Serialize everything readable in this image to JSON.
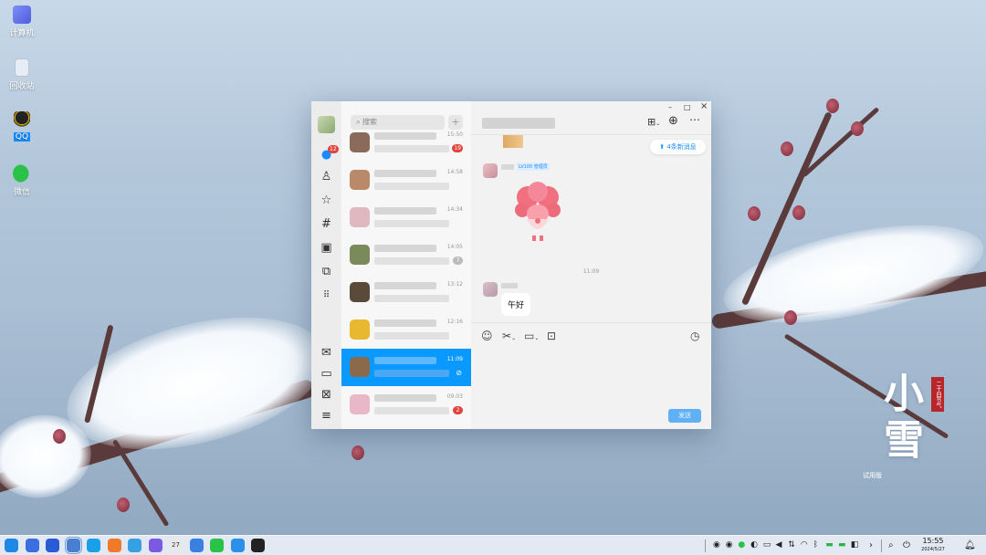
{
  "desktop": {
    "icons": [
      {
        "label": "计算机",
        "icon": "computer-icon",
        "color": "#6a7cf0"
      },
      {
        "label": "回收站",
        "icon": "recycle-bin-icon",
        "color": "#dfe8f2"
      },
      {
        "label": "QQ",
        "icon": "qq-icon",
        "color": "#1a1a1a"
      },
      {
        "label": "微信",
        "icon": "wechat-icon",
        "color": "#2bc24a"
      }
    ],
    "calligraphy": {
      "line1": "小",
      "line2": "雪",
      "seal": "二十四节气",
      "caption": "试用版"
    }
  },
  "qq_window": {
    "controls": {
      "minimize": "–",
      "maximize": "□",
      "close": "×"
    },
    "rail": {
      "unread_badge": "12",
      "top_icons": [
        "chat-icon",
        "contacts-icon",
        "star-icon",
        "channel-hash-icon",
        "video-icon",
        "apps-icon",
        "more-apps-icon"
      ],
      "bottom_icons": [
        "mail-icon",
        "folder-icon",
        "favorites-icon",
        "menu-icon"
      ]
    },
    "search": {
      "placeholder": "搜索",
      "add": "+"
    },
    "conversations": [
      {
        "time": "15:50",
        "badge": "19",
        "selected": false,
        "avatar": "#8a6a5a"
      },
      {
        "time": "14:58",
        "badge": "",
        "selected": false,
        "avatar": "#b88a6a"
      },
      {
        "time": "14:34",
        "badge": "",
        "selected": false,
        "avatar": "#e0b8c0"
      },
      {
        "time": "14:05",
        "badge": "7",
        "selected": false,
        "avatar": "#7a8a5a"
      },
      {
        "time": "13:12",
        "badge": "",
        "selected": false,
        "avatar": "#5a4a3a"
      },
      {
        "time": "12:16",
        "badge": "",
        "selected": false,
        "avatar": "#e8b830"
      },
      {
        "time": "11:09",
        "badge": "",
        "selected": true,
        "avatar": "#8a6a4a"
      },
      {
        "time": "09:03",
        "badge": "2",
        "selected": false,
        "avatar": "#e8b8c8"
      }
    ],
    "chat": {
      "new_messages": "4条新消息",
      "sender_tag": "LV100 管理员",
      "timestamp": "11:09",
      "message": "午好",
      "send": "发送"
    }
  },
  "taskbar": {
    "apps": [
      {
        "icon": "launcher-icon",
        "color": "#1e88e5"
      },
      {
        "icon": "home-icon",
        "color": "#3b6fe0"
      },
      {
        "icon": "multitask-icon",
        "color": "#2a5bd7"
      },
      {
        "icon": "file-manager-icon",
        "color": "#4a7fd0"
      },
      {
        "icon": "browser-icon",
        "color": "#1aa0e8"
      },
      {
        "icon": "app-store-icon",
        "color": "#f07a2a"
      },
      {
        "icon": "photos-icon",
        "color": "#37a0e0"
      },
      {
        "icon": "music-icon",
        "color": "#7a5ae0"
      },
      {
        "icon": "calendar-icon",
        "color": "#e8e8e8"
      },
      {
        "icon": "settings-icon",
        "color": "#3a80e0"
      },
      {
        "icon": "wechat-icon",
        "color": "#2bc24a"
      },
      {
        "icon": "gallery-icon",
        "color": "#2a90e8"
      },
      {
        "icon": "qq-icon",
        "color": "#222222"
      }
    ],
    "calendar_day": "27",
    "tray_icons": [
      "qq-tray-icon",
      "qq-tray-icon-2",
      "wechat-tray-icon",
      "input-method-icon",
      "keyboard-icon",
      "volume-icon",
      "network-icon",
      "wifi-icon",
      "bluetooth-icon",
      "battery-icon",
      "battery-2-icon",
      "switch-icon"
    ],
    "clock": {
      "time": "15:55",
      "date": "2024/5/27"
    }
  }
}
